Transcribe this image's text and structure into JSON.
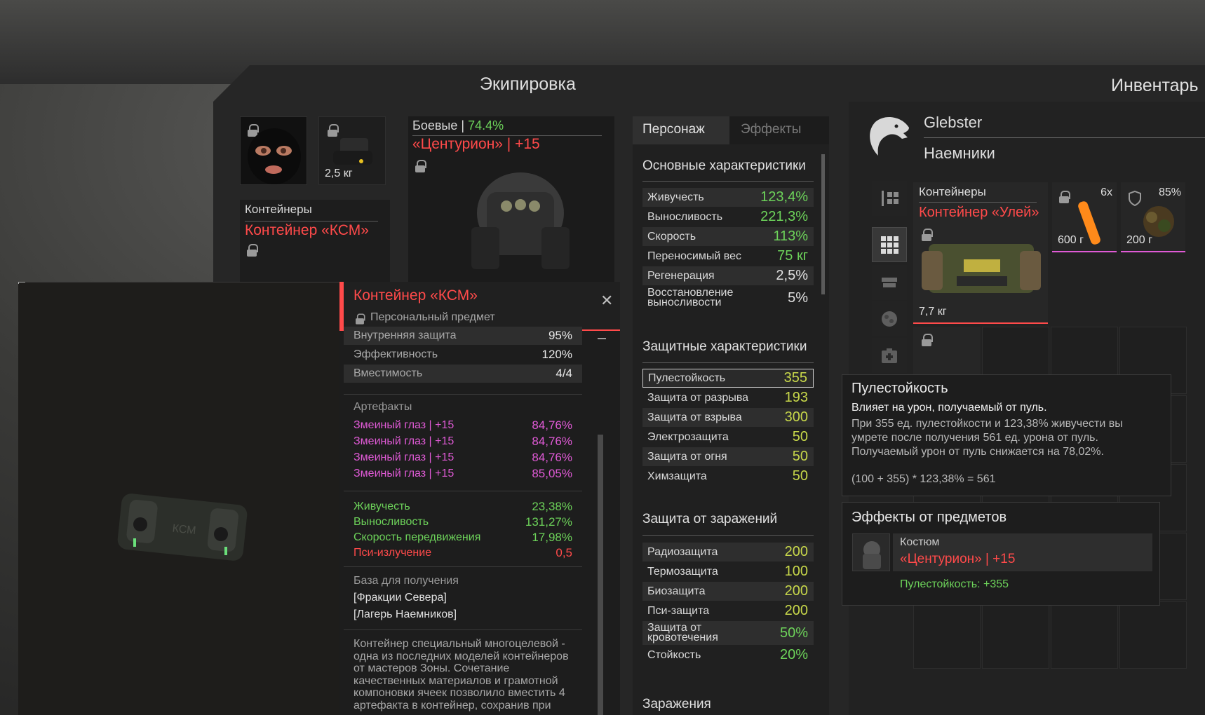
{
  "headers": {
    "equipment": "Экипировка",
    "inventory": "Инвентарь"
  },
  "equip": {
    "slot_weight": "2,5 кг",
    "container_slot": {
      "label": "Контейнеры",
      "name": "Контейнер «КСМ»"
    },
    "armor_slot": {
      "type": "Боевые",
      "sep": "|",
      "percent": "74.4%",
      "name": "«Центурион» | +15"
    }
  },
  "tabs": {
    "character": "Персонаж",
    "effects": "Эффекты"
  },
  "stats": {
    "main_title": "Основные характеристики",
    "main": [
      {
        "label": "Живучесть",
        "value": "123,4%",
        "color": "#6dd35a"
      },
      {
        "label": "Выносливость",
        "value": "221,3%",
        "color": "#6dd35a"
      },
      {
        "label": "Скорость",
        "value": "113%",
        "color": "#6dd35a"
      },
      {
        "label": "Переносимый вес",
        "value": "75 кг",
        "color": "#6dd35a"
      },
      {
        "label": "Регенерация",
        "value": "2,5%",
        "color": "#e0e0e0"
      },
      {
        "label": "Восстановление выносливости",
        "value": "5%",
        "color": "#e0e0e0"
      }
    ],
    "protect_title": "Защитные характеристики",
    "protect": [
      {
        "label": "Пулестойкость",
        "value": "355"
      },
      {
        "label": "Защита от разрыва",
        "value": "193"
      },
      {
        "label": "Защита от взрыва",
        "value": "300"
      },
      {
        "label": "Электрозащита",
        "value": "50"
      },
      {
        "label": "Защита от огня",
        "value": "50"
      },
      {
        "label": "Химзащита",
        "value": "50"
      }
    ],
    "contam_title": "Защита от заражений",
    "contam": [
      {
        "label": "Радиозащита",
        "value": "200"
      },
      {
        "label": "Термозащита",
        "value": "100"
      },
      {
        "label": "Биозащита",
        "value": "200"
      },
      {
        "label": "Пси-защита",
        "value": "200"
      },
      {
        "label": "Защита от кровотечения",
        "value": "50%"
      },
      {
        "label": "Стойкость",
        "value": "20%"
      }
    ],
    "infect_title": "Заражения"
  },
  "player": {
    "name": "Glebster",
    "faction": "Наемники"
  },
  "inventory": {
    "container_label": "Контейнеры",
    "container_name": "Контейнер «Улей»",
    "container_weight": "7,7 кг",
    "item2_count": "6x",
    "item2_weight": "600 г",
    "item3_percent": "85%",
    "item3_weight": "200 г"
  },
  "tooltip": {
    "title": "Контейнер «КСМ»",
    "subtitle": "Персональный предмет",
    "props": [
      {
        "label": "Внутренняя защита",
        "value": "95%"
      },
      {
        "label": "Эффективность",
        "value": "120%"
      },
      {
        "label": "Вместимость",
        "value": "4/4"
      }
    ],
    "artifacts_title": "Артефакты",
    "artifacts": [
      {
        "label": "Змеиный глаз | +15",
        "value": "84,76%"
      },
      {
        "label": "Змеиный глаз | +15",
        "value": "84,76%"
      },
      {
        "label": "Змеиный глаз | +15",
        "value": "84,76%"
      },
      {
        "label": "Змеиный глаз | +15",
        "value": "85,05%"
      }
    ],
    "bonuses": [
      {
        "label": "Живучесть",
        "value": "23,38%",
        "color": "#6dd35a"
      },
      {
        "label": "Выносливость",
        "value": "131,27%",
        "color": "#6dd35a"
      },
      {
        "label": "Скорость передвижения",
        "value": "17,98%",
        "color": "#6dd35a"
      },
      {
        "label": "Пси-излучение",
        "value": "0,5",
        "color": "#ff4a4a"
      }
    ],
    "base_title": "База для получения",
    "base_1": "[Фракции Севера]",
    "base_2": "[Лагерь Наемников]",
    "description": "Контейнер специальный многоцелевой - одна из последних моделей контейнеров от мастеров Зоны. Сочетание качественных материалов и грамотной компоновки ячеек позволило вместить 4 артефакта в контейнер, сохранив при",
    "preview_text": "КСМ"
  },
  "bullet_tip": {
    "title": "Пулестойкость",
    "subtitle": "Влияет на урон, получаемый от пуль.",
    "body": "При 355 ед. пулестойкости и 123,38% живучести вы умрете после получения 561 ед. урона от пуль. Получаемый урон от пуль снижается на 78,02%.",
    "formula": "(100 + 355) * 123,38% = 561"
  },
  "effects_box": {
    "title": "Эффекты от предметов",
    "item_type": "Костюм",
    "item_name": "«Центурион» | +15",
    "effect": "Пулестойкость: +355"
  }
}
